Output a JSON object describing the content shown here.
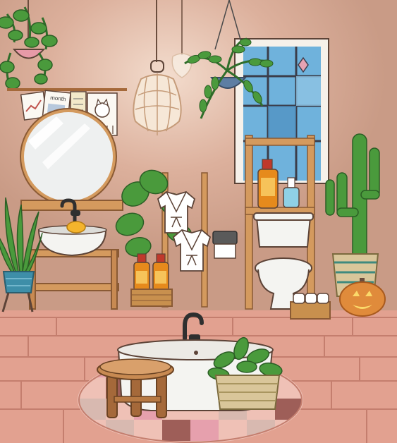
{
  "scene": {
    "room": "bathroom",
    "style": "toca-boca-style illustration",
    "colors": {
      "wall": "#d3a893",
      "wall_light": "#e6c8b7",
      "floor": "#e2a190",
      "floor_line": "#c47e6e",
      "wood": "#d49a5e",
      "wood_dark": "#a5693a",
      "porcelain": "#f4f4f1",
      "outline": "#5c4337",
      "plant": "#4a9a3c",
      "plant_dark": "#2f6e2a",
      "window_glass": "#5fa3d1",
      "rug_pink": "#e6a0ad",
      "pumpkin": "#e08b3b"
    }
  },
  "wall_papers": {
    "calendar_text": "month"
  },
  "items": {
    "hanging_plant_left": "hanging-plant",
    "pendant_lamp": "rattan-pendant-lamp",
    "hanging_fern": "hanging-fern",
    "window": "stained-glass-window",
    "mirror": "round-mirror",
    "sink": "vessel-sink",
    "potted_snake_plant": "snake-plant",
    "fiddle_leaf": "fiddle-leaf-fig",
    "robes": "bathrobes",
    "lotion_basket": "lotion-basket",
    "toilet_paper": "toilet-paper-holder",
    "toilet": "toilet",
    "shelf_bottles": "shelf-bottles",
    "cactus": "cactus-in-basket",
    "jack_o_lantern": "jack-o-lantern",
    "tp_basket": "toilet-roll-basket",
    "bathtub": "bathtub",
    "stool": "wooden-stool",
    "basket_plant": "basket-plant",
    "rug": "round-rug"
  }
}
